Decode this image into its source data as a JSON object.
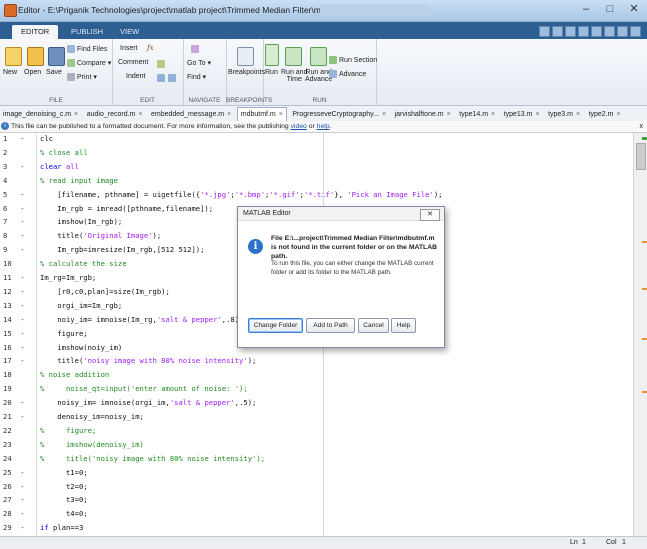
{
  "window": {
    "title": "Editor - E:\\Priganik Technologies\\project\\matlab project\\Trimmed Median Filter\\mdbutmf.m",
    "controls": [
      "–",
      "□",
      "✕"
    ]
  },
  "ribbon_tabs": [
    "EDITOR",
    "PUBLISH",
    "VIEW"
  ],
  "ribbon": {
    "file": {
      "new": "New",
      "open": "Open",
      "save": "Save",
      "find_files": "Find Files",
      "compare": "Compare ▾",
      "print": "Print ▾",
      "label": "FILE"
    },
    "edit": {
      "insert": "Insert",
      "fx": "fx",
      "comment": "Comment",
      "indent": "Indent",
      "label": "EDIT"
    },
    "navigate": {
      "goto": "Go To ▾",
      "find": "Find ▾",
      "label": "NAVIGATE"
    },
    "breakpoints": {
      "breakpoints": "Breakpoints",
      "label": "BREAKPOINTS"
    },
    "run": {
      "run": "Run",
      "run_and_time": "Run and\nTime",
      "run_and_advance": "Run and\nAdvance",
      "run_section": "Run Section",
      "advance": "Advance",
      "label": "RUN"
    }
  },
  "file_tabs": [
    "image_denoising_c.m",
    "audio_record.m",
    "embedded_message.m",
    "mdbutmf.m",
    "ProgresseveCryptography...",
    "jarvishalftone.m",
    "type14.m",
    "type13.m",
    "type3.m",
    "type2.m"
  ],
  "infobar": {
    "text": "This file can be published to a formatted document. For more information, see the publishing",
    "link1": "video",
    "or": "or",
    "link2": "help",
    "close": "x"
  },
  "code_lines": [
    {
      "n": "1",
      "dash": "-",
      "text": "clc"
    },
    {
      "n": "2",
      "dash": "",
      "text": "% close all"
    },
    {
      "n": "3",
      "dash": "-",
      "text": "clear all"
    },
    {
      "n": "4",
      "dash": "",
      "text": "% read input image"
    },
    {
      "n": "5",
      "dash": "-",
      "text": "[filename, pthname] = uigetfile({'*.jpg';'*.bmp';'*.gif';'*.tif'}, 'Pick an Image File');"
    },
    {
      "n": "6",
      "dash": "-",
      "text": "Im_rgb = imread([pthname,filename]);"
    },
    {
      "n": "7",
      "dash": "-",
      "text": "imshow(Im_rgb);"
    },
    {
      "n": "8",
      "dash": "-",
      "text": "title('Original Image');"
    },
    {
      "n": "9",
      "dash": "-",
      "text": "Im_rgb=imresize(Im_rgb,[512 512]);"
    },
    {
      "n": "10",
      "dash": "",
      "text": "% calculate the size"
    },
    {
      "n": "11",
      "dash": "-",
      "text": "Im_rg=Im_rgb;"
    },
    {
      "n": "12",
      "dash": "-",
      "text": "[r0,c0,plan]=size(Im_rgb);"
    },
    {
      "n": "13",
      "dash": "-",
      "text": "orgi_im=Im_rgb;"
    },
    {
      "n": "14",
      "dash": "-",
      "text": "noiy_im= imnoise(Im_rg,'salt & pepper',.8);"
    },
    {
      "n": "15",
      "dash": "-",
      "text": "figure;"
    },
    {
      "n": "16",
      "dash": "-",
      "text": "imshow(noiy_im)"
    },
    {
      "n": "17",
      "dash": "-",
      "text": "title('noisy image with 80% noise intensity');"
    },
    {
      "n": "18",
      "dash": "",
      "text": "% noise addition"
    },
    {
      "n": "19",
      "dash": "",
      "text": "%     noise_qt=input('enter amount of noise: ');"
    },
    {
      "n": "20",
      "dash": "-",
      "text": "noisy_im= imnoise(orgi_im,'salt & pepper',.5);"
    },
    {
      "n": "21",
      "dash": "-",
      "text": "denoisy_im=noisy_im;"
    },
    {
      "n": "22",
      "dash": "",
      "text": "%     figure;"
    },
    {
      "n": "23",
      "dash": "",
      "text": "%     imshow(denoisy_im)"
    },
    {
      "n": "24",
      "dash": "",
      "text": "%     title('noisy image with 80% noise intensity');"
    },
    {
      "n": "25",
      "dash": "-",
      "text": "t1=0;"
    },
    {
      "n": "26",
      "dash": "-",
      "text": "t2=0;"
    },
    {
      "n": "27",
      "dash": "-",
      "text": "t3=0;"
    },
    {
      "n": "28",
      "dash": "-",
      "text": "t4=0;"
    },
    {
      "n": "29",
      "dash": "-",
      "text": "if plan==3"
    }
  ],
  "dialog": {
    "title": "MATLAB Editor",
    "close": "✕",
    "message": "File E:\\...project\\Trimmed Median Filter\\mdbutmf.m is not found in the current folder or on the MATLAB path.",
    "sub": "To run this file, you can either change the MATLAB current folder or add its folder to the MATLAB path.",
    "buttons": {
      "change_folder": "Change Folder",
      "add_to_path": "Add to Path",
      "cancel": "Cancel",
      "help": "Help"
    }
  },
  "status": {
    "ln_label": "Ln",
    "ln": "1",
    "col_label": "Col",
    "col": "1"
  },
  "colors": {
    "comment": "#228b22",
    "string": "#a020f0",
    "keyword": "#0000ff",
    "ribbon_tabs_bg": "#2d5f93",
    "titlebar_bg": "#b6d0ea"
  }
}
